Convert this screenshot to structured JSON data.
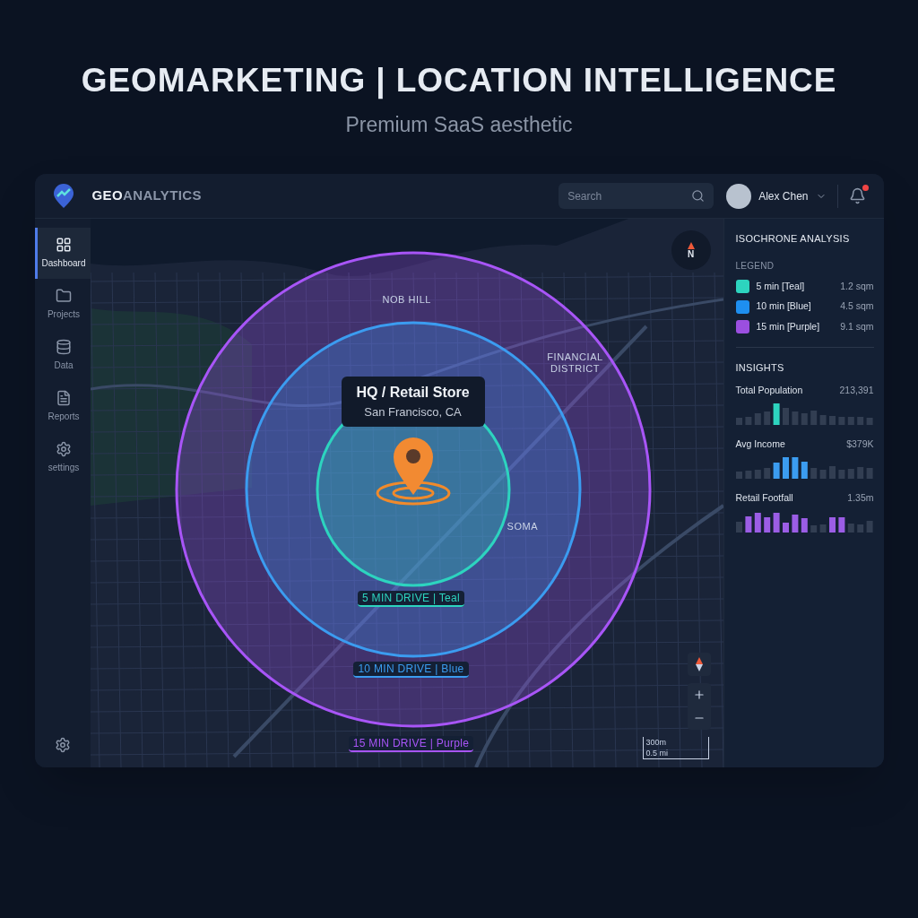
{
  "heading": {
    "title": "GEOMARKETING | LOCATION INTELLIGENCE",
    "subtitle": "Premium SaaS aesthetic"
  },
  "app": {
    "brand": {
      "bold": "GEO",
      "rest": "ANALYTICS"
    },
    "search": {
      "placeholder": "Search"
    },
    "user": {
      "name": "Alex Chen",
      "has_notification": true
    },
    "nav": [
      {
        "label": "Dashboard",
        "selected": true
      },
      {
        "label": "Projects",
        "selected": false
      },
      {
        "label": "Data",
        "selected": false
      },
      {
        "label": "Reports",
        "selected": false
      },
      {
        "label": "settings",
        "selected": false
      }
    ],
    "map": {
      "pin": {
        "title": "HQ / Retail Store",
        "subtitle": "San Francisco, CA"
      },
      "districts": [
        "NOB HILL",
        "FINANCIAL DISTRICT",
        "SOMA"
      ],
      "zones": [
        {
          "label": "5 MIN DRIVE | Teal",
          "color": "#2dd4bf"
        },
        {
          "label": "10 MIN DRIVE | Blue",
          "color": "#3b9cf0"
        },
        {
          "label": "15 MIN DRIVE | Purple",
          "color": "#a855f7"
        }
      ],
      "compass": "N",
      "scale": [
        "300m",
        "0.5 mi"
      ]
    },
    "panel": {
      "title": "ISOCHRONE ANALYSIS",
      "legend_title": "LEGEND",
      "legend": [
        {
          "label": "5 min [Teal]",
          "value": "1.2 sqm",
          "color": "#2dd4bf"
        },
        {
          "label": "10 min [Blue]",
          "value": "4.5 sqm",
          "color": "#1e8ff0"
        },
        {
          "label": "15 min [Purple]",
          "value": "9.1 sqm",
          "color": "#9b4fe0"
        }
      ],
      "insights_title": "INSIGHTS",
      "insights": [
        {
          "label": "Total Population",
          "value": "213,391",
          "color": "#2dd4bf"
        },
        {
          "label": "Avg Income",
          "value": "$379K",
          "color": "#3b9cf0"
        },
        {
          "label": "Retail Footfall",
          "value": "1.35m",
          "color": "#9b5de5"
        }
      ]
    }
  }
}
